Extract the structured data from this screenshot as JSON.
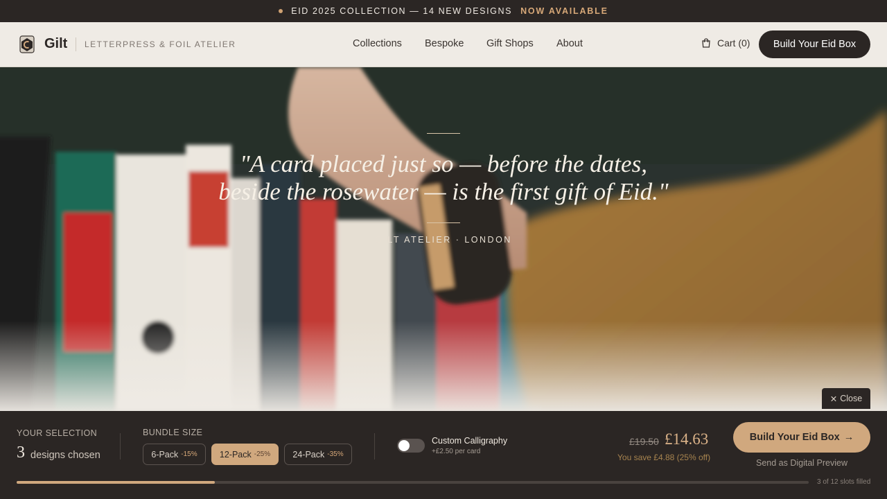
{
  "announcement": {
    "text": "EID 2025 COLLECTION — 14 NEW DESIGNS",
    "cta": "NOW AVAILABLE"
  },
  "header": {
    "brand": "Gilt",
    "tagline": "LETTERPRESS & FOIL ATELIER",
    "nav": [
      "Collections",
      "Bespoke",
      "Gift Shops",
      "About"
    ],
    "cart": "Cart (0)",
    "cta": "Build Your Eid Box"
  },
  "hero": {
    "quote_line1": "\"A card placed just so — before the dates,",
    "quote_line2": "beside the rosewater — is the first gift of Eid.\"",
    "source": "GILT ATELIER · LONDON",
    "close_label": "Close"
  },
  "selection": {
    "label": "YOUR SELECTION",
    "count": "3",
    "count_text": "designs chosen"
  },
  "bundle": {
    "label": "BUNDLE SIZE",
    "packs": [
      {
        "name": "6-Pack",
        "discount": "-15%"
      },
      {
        "name": "12-Pack",
        "discount": "-25%",
        "selected": true
      },
      {
        "name": "24-Pack",
        "discount": "-35%"
      }
    ]
  },
  "calligraphy": {
    "title": "Custom Calligraphy",
    "subtitle": "+£2.50 per card",
    "enabled": false
  },
  "pricing": {
    "original": "£19.50",
    "current": "£14.63",
    "saving": "You save £4.88 (25% off)"
  },
  "actions": {
    "build": "Build Your Eid Box",
    "build_arrow": "→",
    "preview": "Send as Digital Preview"
  },
  "progress": {
    "filled": 3,
    "total": 12,
    "label": "3 of 12 slots filled"
  },
  "colors": {
    "dark": "#2b2624",
    "gold": "#d0a87e",
    "cream": "#efebe5"
  }
}
